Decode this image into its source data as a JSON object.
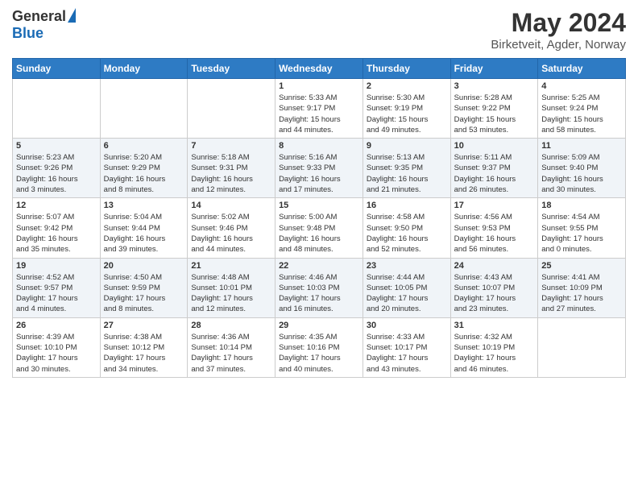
{
  "logo": {
    "general": "General",
    "blue": "Blue"
  },
  "title": {
    "month_year": "May 2024",
    "location": "Birketveit, Agder, Norway"
  },
  "days_of_week": [
    "Sunday",
    "Monday",
    "Tuesday",
    "Wednesday",
    "Thursday",
    "Friday",
    "Saturday"
  ],
  "weeks": [
    [
      {
        "day": "",
        "info": ""
      },
      {
        "day": "",
        "info": ""
      },
      {
        "day": "",
        "info": ""
      },
      {
        "day": "1",
        "info": "Sunrise: 5:33 AM\nSunset: 9:17 PM\nDaylight: 15 hours\nand 44 minutes."
      },
      {
        "day": "2",
        "info": "Sunrise: 5:30 AM\nSunset: 9:19 PM\nDaylight: 15 hours\nand 49 minutes."
      },
      {
        "day": "3",
        "info": "Sunrise: 5:28 AM\nSunset: 9:22 PM\nDaylight: 15 hours\nand 53 minutes."
      },
      {
        "day": "4",
        "info": "Sunrise: 5:25 AM\nSunset: 9:24 PM\nDaylight: 15 hours\nand 58 minutes."
      }
    ],
    [
      {
        "day": "5",
        "info": "Sunrise: 5:23 AM\nSunset: 9:26 PM\nDaylight: 16 hours\nand 3 minutes."
      },
      {
        "day": "6",
        "info": "Sunrise: 5:20 AM\nSunset: 9:29 PM\nDaylight: 16 hours\nand 8 minutes."
      },
      {
        "day": "7",
        "info": "Sunrise: 5:18 AM\nSunset: 9:31 PM\nDaylight: 16 hours\nand 12 minutes."
      },
      {
        "day": "8",
        "info": "Sunrise: 5:16 AM\nSunset: 9:33 PM\nDaylight: 16 hours\nand 17 minutes."
      },
      {
        "day": "9",
        "info": "Sunrise: 5:13 AM\nSunset: 9:35 PM\nDaylight: 16 hours\nand 21 minutes."
      },
      {
        "day": "10",
        "info": "Sunrise: 5:11 AM\nSunset: 9:37 PM\nDaylight: 16 hours\nand 26 minutes."
      },
      {
        "day": "11",
        "info": "Sunrise: 5:09 AM\nSunset: 9:40 PM\nDaylight: 16 hours\nand 30 minutes."
      }
    ],
    [
      {
        "day": "12",
        "info": "Sunrise: 5:07 AM\nSunset: 9:42 PM\nDaylight: 16 hours\nand 35 minutes."
      },
      {
        "day": "13",
        "info": "Sunrise: 5:04 AM\nSunset: 9:44 PM\nDaylight: 16 hours\nand 39 minutes."
      },
      {
        "day": "14",
        "info": "Sunrise: 5:02 AM\nSunset: 9:46 PM\nDaylight: 16 hours\nand 44 minutes."
      },
      {
        "day": "15",
        "info": "Sunrise: 5:00 AM\nSunset: 9:48 PM\nDaylight: 16 hours\nand 48 minutes."
      },
      {
        "day": "16",
        "info": "Sunrise: 4:58 AM\nSunset: 9:50 PM\nDaylight: 16 hours\nand 52 minutes."
      },
      {
        "day": "17",
        "info": "Sunrise: 4:56 AM\nSunset: 9:53 PM\nDaylight: 16 hours\nand 56 minutes."
      },
      {
        "day": "18",
        "info": "Sunrise: 4:54 AM\nSunset: 9:55 PM\nDaylight: 17 hours\nand 0 minutes."
      }
    ],
    [
      {
        "day": "19",
        "info": "Sunrise: 4:52 AM\nSunset: 9:57 PM\nDaylight: 17 hours\nand 4 minutes."
      },
      {
        "day": "20",
        "info": "Sunrise: 4:50 AM\nSunset: 9:59 PM\nDaylight: 17 hours\nand 8 minutes."
      },
      {
        "day": "21",
        "info": "Sunrise: 4:48 AM\nSunset: 10:01 PM\nDaylight: 17 hours\nand 12 minutes."
      },
      {
        "day": "22",
        "info": "Sunrise: 4:46 AM\nSunset: 10:03 PM\nDaylight: 17 hours\nand 16 minutes."
      },
      {
        "day": "23",
        "info": "Sunrise: 4:44 AM\nSunset: 10:05 PM\nDaylight: 17 hours\nand 20 minutes."
      },
      {
        "day": "24",
        "info": "Sunrise: 4:43 AM\nSunset: 10:07 PM\nDaylight: 17 hours\nand 23 minutes."
      },
      {
        "day": "25",
        "info": "Sunrise: 4:41 AM\nSunset: 10:09 PM\nDaylight: 17 hours\nand 27 minutes."
      }
    ],
    [
      {
        "day": "26",
        "info": "Sunrise: 4:39 AM\nSunset: 10:10 PM\nDaylight: 17 hours\nand 30 minutes."
      },
      {
        "day": "27",
        "info": "Sunrise: 4:38 AM\nSunset: 10:12 PM\nDaylight: 17 hours\nand 34 minutes."
      },
      {
        "day": "28",
        "info": "Sunrise: 4:36 AM\nSunset: 10:14 PM\nDaylight: 17 hours\nand 37 minutes."
      },
      {
        "day": "29",
        "info": "Sunrise: 4:35 AM\nSunset: 10:16 PM\nDaylight: 17 hours\nand 40 minutes."
      },
      {
        "day": "30",
        "info": "Sunrise: 4:33 AM\nSunset: 10:17 PM\nDaylight: 17 hours\nand 43 minutes."
      },
      {
        "day": "31",
        "info": "Sunrise: 4:32 AM\nSunset: 10:19 PM\nDaylight: 17 hours\nand 46 minutes."
      },
      {
        "day": "",
        "info": ""
      }
    ]
  ]
}
